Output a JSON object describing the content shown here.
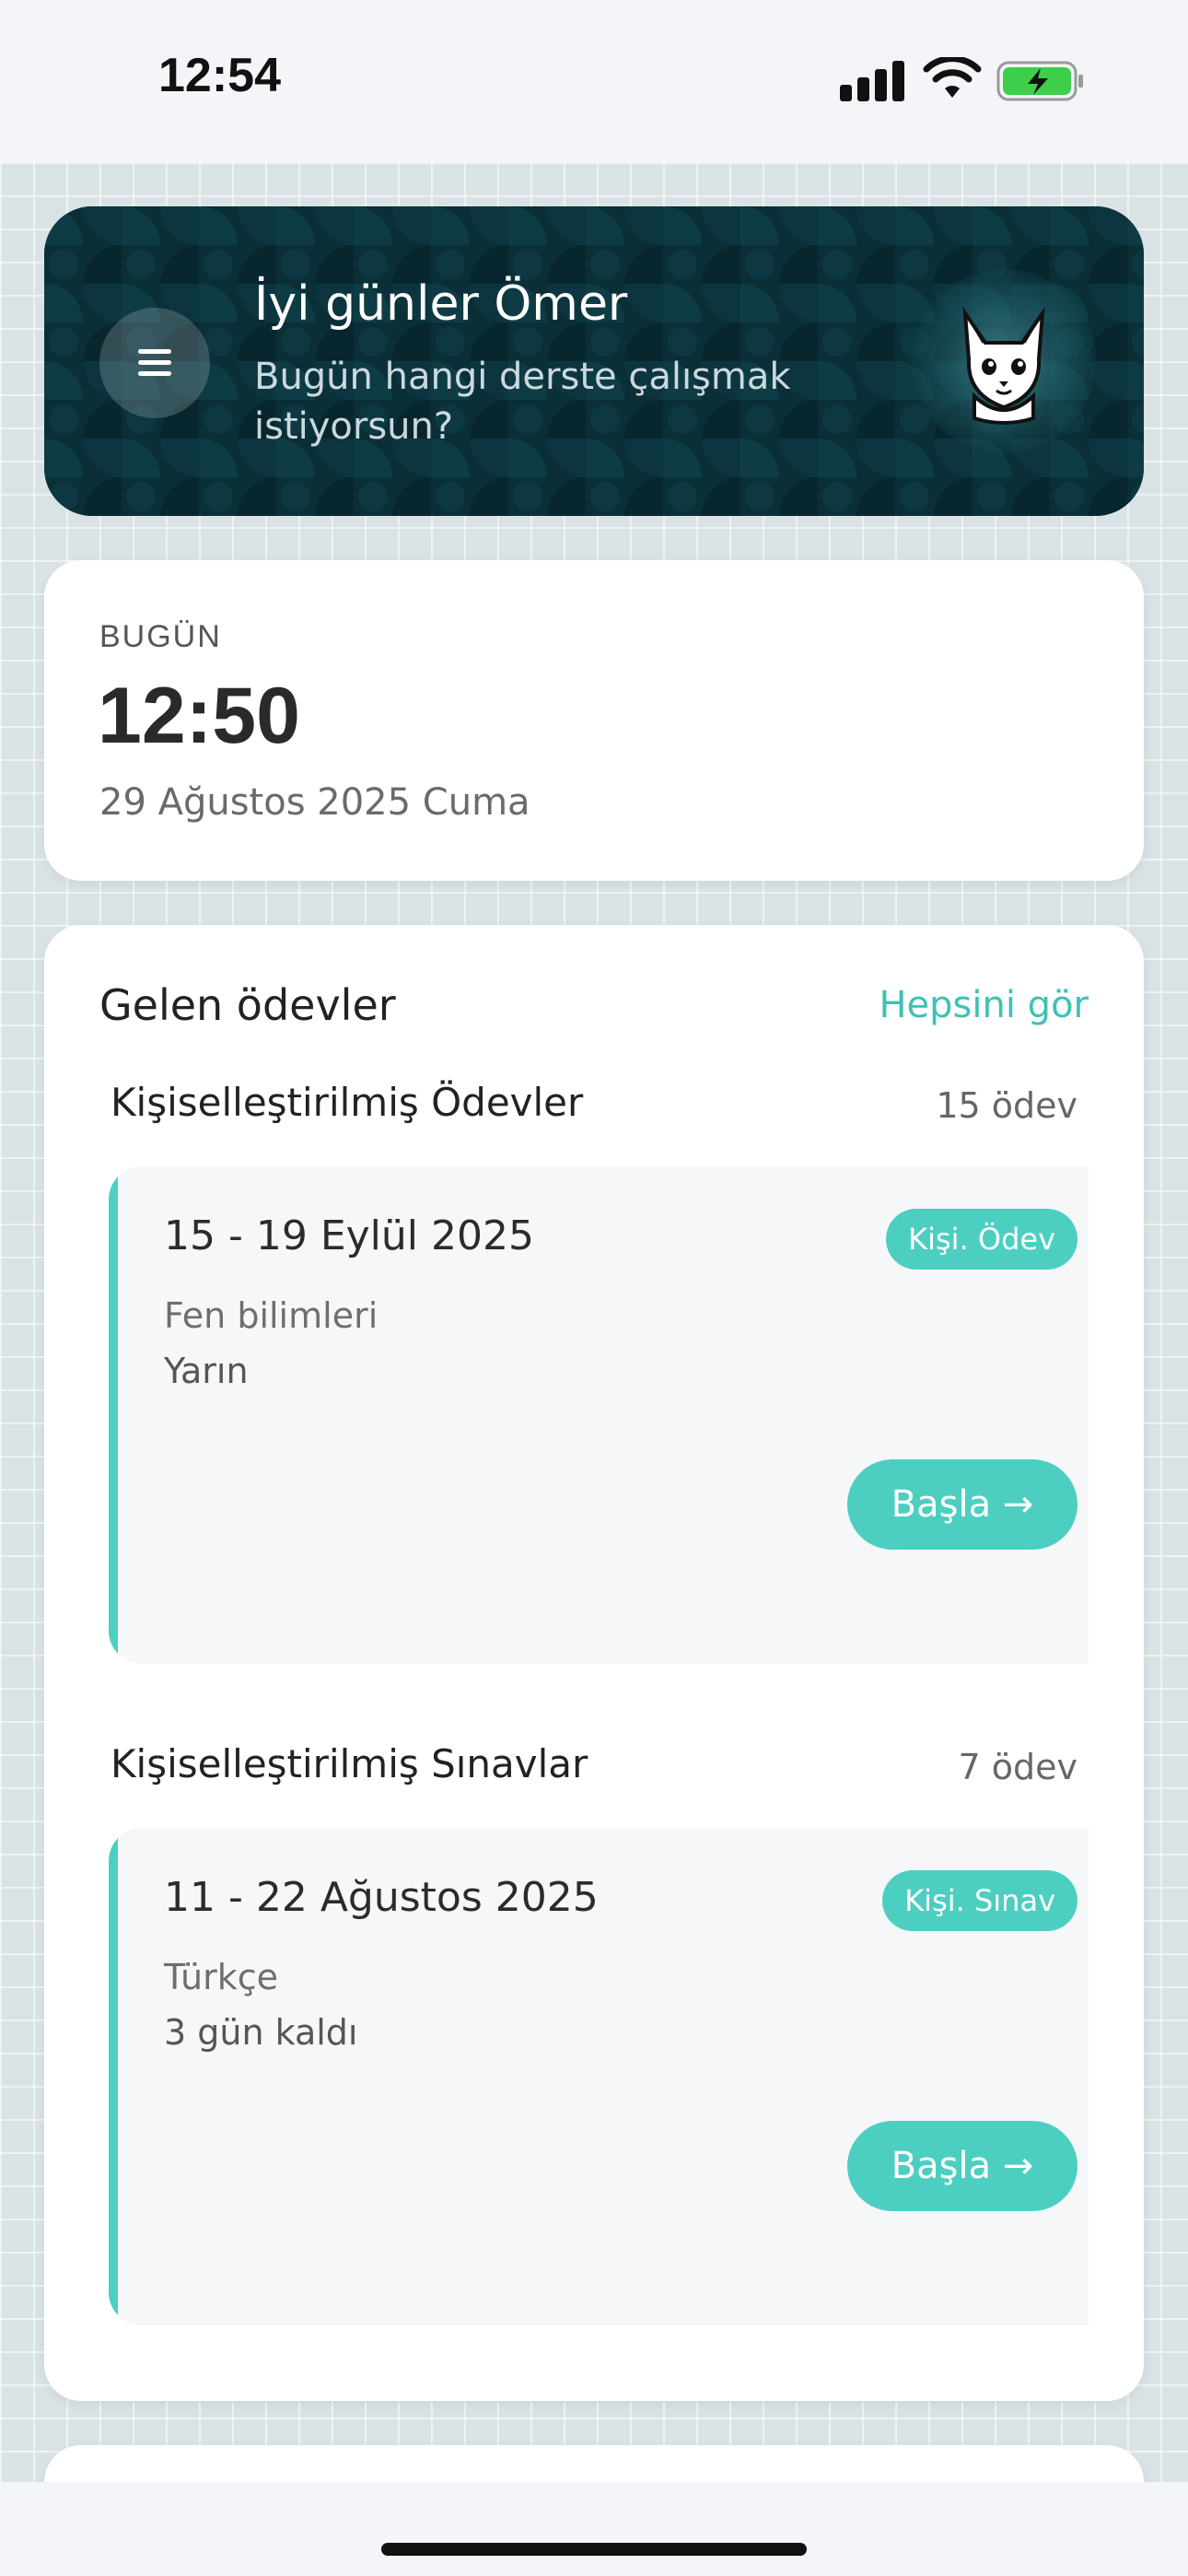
{
  "status_bar": {
    "time": "12:54",
    "icons": [
      "signal-icon",
      "wifi-icon",
      "battery-charging-icon"
    ],
    "battery_color": "#3ecf4a"
  },
  "header": {
    "greeting": "İyi günler Ömer",
    "subtitle": "Bugün hangi derste çalışmak istiyorsun?",
    "menu_icon": "hamburger-menu-icon",
    "avatar_icon": "fox-mascot-icon",
    "background_color": "#0a2f37"
  },
  "today": {
    "label": "BUGÜN",
    "time": "12:50",
    "date": "29 Ağustos 2025 Cuma"
  },
  "homework": {
    "title": "Gelen ödevler",
    "see_all": "Hepsini gör",
    "accent_color": "#4ccfc1",
    "sections": [
      {
        "title": "Kişiselleştirilmiş Ödevler",
        "count": "15 ödev",
        "task": {
          "title": "15 - 19 Eylül 2025",
          "badge": "Kişi. Ödev",
          "subject": "Fen bilimleri",
          "due": "Yarın",
          "button": "Başla →"
        }
      },
      {
        "title": "Kişiselleştirilmiş Sınavlar",
        "count": "7 ödev",
        "task": {
          "title": "11 - 22 Ağustos 2025",
          "badge": "Kişi. Sınav",
          "subject": "Türkçe",
          "due": "3 gün kaldı",
          "button": "Başla →"
        }
      }
    ]
  }
}
